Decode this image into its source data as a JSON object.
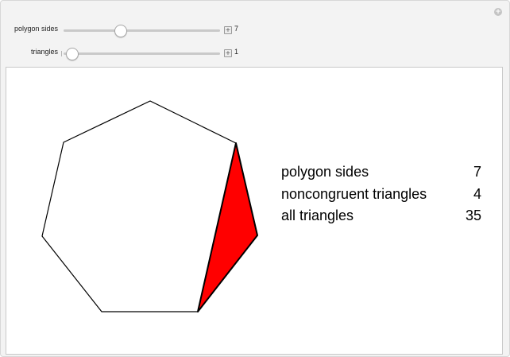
{
  "controls": {
    "polygon_sides": {
      "label": "polygon sides",
      "value": "7",
      "fraction": 0.36
    },
    "triangles": {
      "label": "triangles",
      "value": "1",
      "fraction": 0.05
    }
  },
  "stats": [
    {
      "label": "polygon sides",
      "value": "7"
    },
    {
      "label": "noncongruent triangles",
      "value": "4"
    },
    {
      "label": "all triangles",
      "value": "35"
    }
  ],
  "icons": {
    "corner": "plus-circle-icon",
    "stepper": "plus-square-icon"
  },
  "colors": {
    "triangle_fill": "#ff0000",
    "polygon_stroke": "#000000"
  }
}
